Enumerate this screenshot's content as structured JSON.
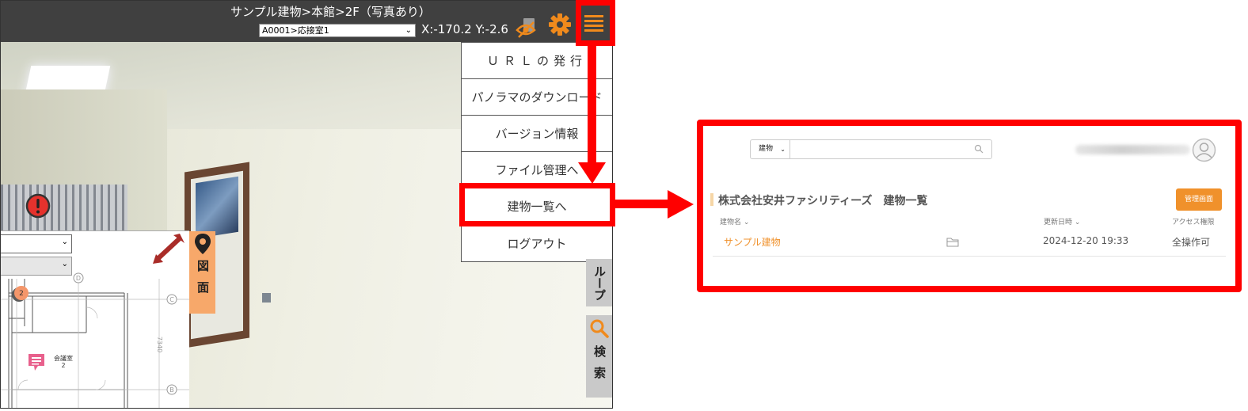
{
  "viewer": {
    "breadcrumb_title": "サンプル建物>本館>2F（写真あり）",
    "room_select_value": "A0001>応接室1",
    "coordinates": "X:-170.2 Y:-2.6",
    "icons": {
      "hide": "eye-slash-icon",
      "document": "document-icon",
      "settings": "gear-icon",
      "menu": "hamburger-menu-icon"
    },
    "menu_items": [
      "ＵＲＬの発行",
      "パノラマのダウンロード",
      "バージョン情報",
      "ファイル管理へ",
      "建物一覧へ",
      "ログアウト"
    ],
    "side_tabs": {
      "map": "図面",
      "group": "ループ",
      "search": "検索"
    },
    "map_panel": {
      "room_label_1": "会議室",
      "room_label_2": "2",
      "marker_count": "2",
      "grid_labels": [
        "D",
        "C",
        "B"
      ],
      "dimension": "7340"
    }
  },
  "building_list": {
    "search_type": "建物",
    "page_title": "株式会社安井ファシリティーズ　建物一覧",
    "admin_button": "管理画面",
    "columns": [
      "建物名",
      "更新日時",
      "アクセス権限"
    ],
    "rows": [
      {
        "name": "サンプル建物",
        "updated": "2024-12-20 19:33",
        "access": "全操作可"
      }
    ]
  },
  "colors": {
    "accent_orange": "#f0912b",
    "highlight_red": "#ff0000",
    "toolbar_dark": "#404040",
    "map_tab_orange": "#f7a86a"
  }
}
